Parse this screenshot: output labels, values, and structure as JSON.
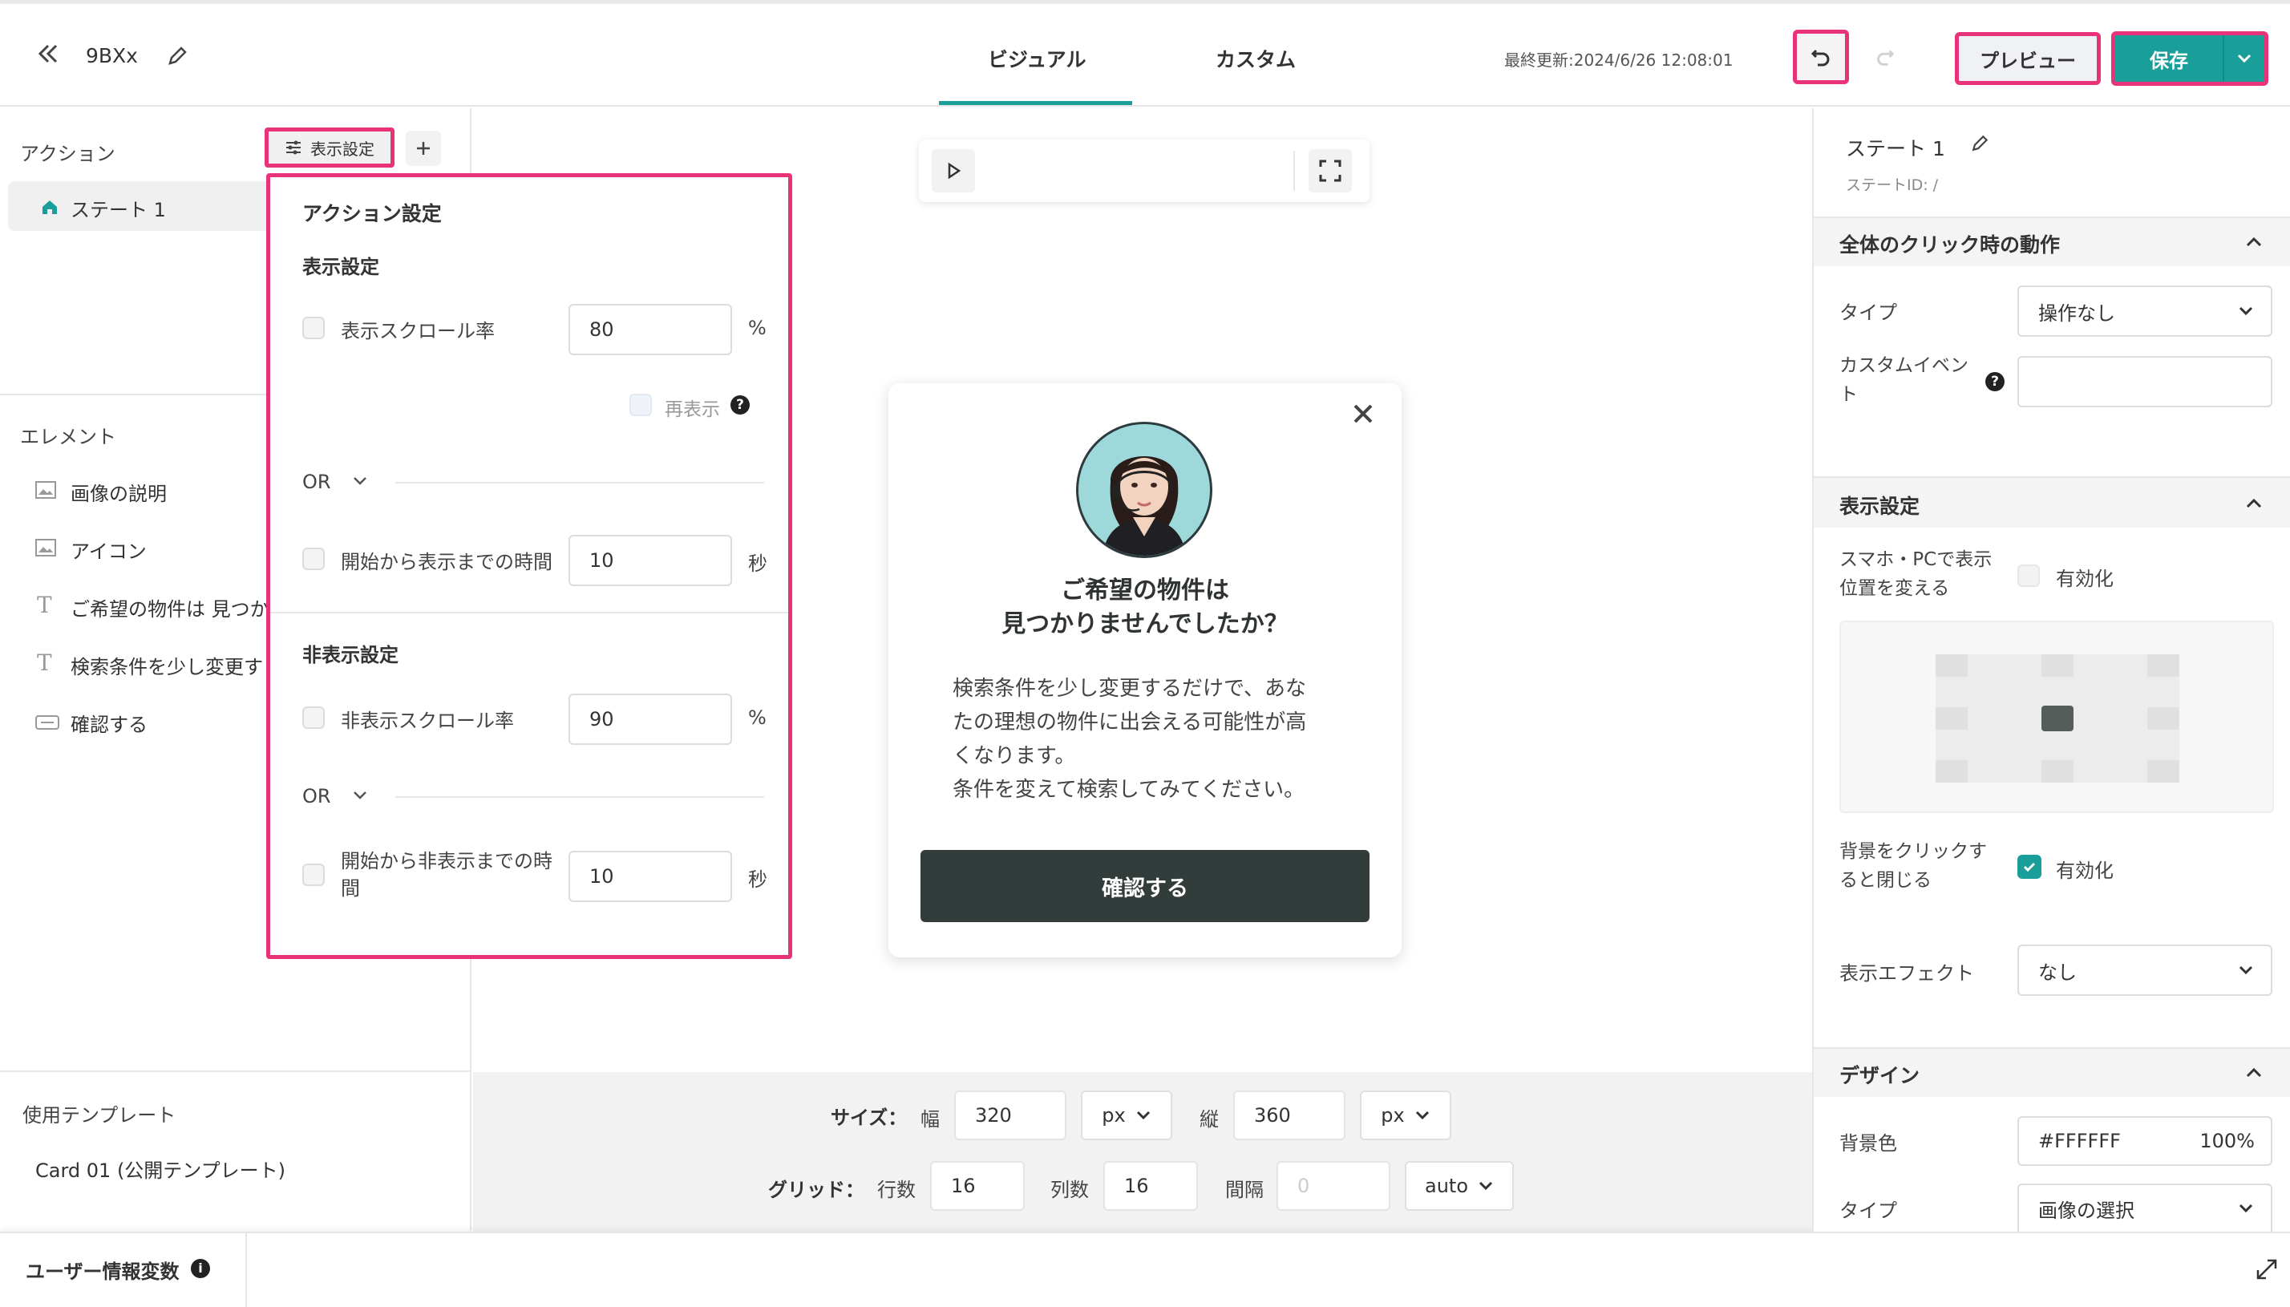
{
  "header": {
    "title": "9BXx",
    "tabs": [
      "ビジュアル",
      "カスタム"
    ],
    "last_updated": "最終更新:2024/6/26 12:08:01",
    "preview_label": "プレビュー",
    "save_label": "保存"
  },
  "left": {
    "actions_label": "アクション",
    "display_settings_btn": "表示設定",
    "state_item": "ステート 1",
    "elements_label": "エレメント",
    "elements": [
      "画像の説明",
      "アイコン",
      "ご希望の物件は 見つか",
      "検索条件を少し変更す",
      "確認する"
    ],
    "template_label": "使用テンプレート",
    "template_name": "Card 01 (公開テンプレート)"
  },
  "popover": {
    "title": "アクション設定",
    "show_section": "表示設定",
    "show_scroll_label": "表示スクロール率",
    "show_scroll_value": "80",
    "percent": "%",
    "redisplay_label": "再表示",
    "or_label": "OR",
    "show_time_label": "開始から表示までの時間",
    "show_time_value": "10",
    "seconds": "秒",
    "hide_section": "非表示設定",
    "hide_scroll_label": "非表示スクロール率",
    "hide_scroll_value": "90",
    "hide_time_label": "開始から非表示までの時間",
    "hide_time_value": "10"
  },
  "modal": {
    "title_line1": "ご希望の物件は",
    "title_line2": "見つかりませんでしたか？",
    "body_line1": "検索条件を少し変更するだけで、あな",
    "body_line2": "たの理想の物件に出会える可能性が高",
    "body_line3": "くなります。",
    "body_line4": "条件を変えて検索してみてください。",
    "button_label": "確認する"
  },
  "bottom": {
    "size_label": "サイズ：",
    "width_label": "幅",
    "width_value": "320",
    "width_unit": "px",
    "height_label": "縦",
    "height_value": "360",
    "height_unit": "px",
    "grid_label": "グリッド：",
    "rows_label": "行数",
    "rows_value": "16",
    "cols_label": "列数",
    "cols_value": "16",
    "gap_label": "間隔",
    "gap_placeholder": "0",
    "gap_unit": "auto"
  },
  "footer": {
    "user_vars_label": "ユーザー情報変数"
  },
  "right": {
    "state_name": "ステート 1",
    "state_id": "ステートID: /",
    "click_section": "全体のクリック時の動作",
    "type_label": "タイプ",
    "type_value": "操作なし",
    "custom_event_label": "カスタムイベント",
    "display_section": "表示設定",
    "change_position_label_1": "スマホ・PCで表示",
    "change_position_label_2": "位置を変える",
    "enable_label": "有効化",
    "close_bg_label_1": "背景をクリックす",
    "close_bg_label_2": "ると閉じる",
    "effect_label": "表示エフェクト",
    "effect_value": "なし",
    "design_section": "デザイン",
    "bg_color_label": "背景色",
    "bg_color_value": "#FFFFFF",
    "bg_opacity": "100%",
    "design_type_label": "タイプ",
    "design_type_value": "画像の選択"
  },
  "colors": {
    "accent_teal": "#1a9e9a",
    "highlight_pink": "#e8337a",
    "modal_button": "#323c3a"
  }
}
